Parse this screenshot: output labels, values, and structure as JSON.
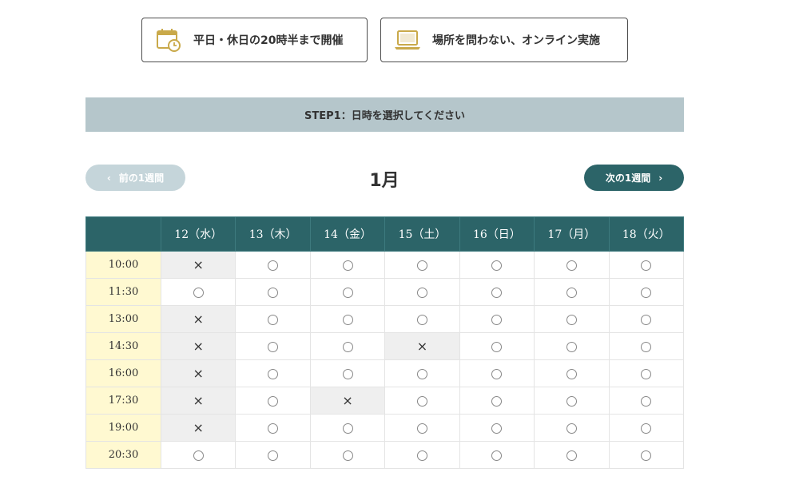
{
  "features": [
    {
      "label": "平日・休日の20時半まで開催",
      "icon": "calendar-clock-icon"
    },
    {
      "label": "場所を問わない、オンライン実施",
      "icon": "laptop-icon"
    }
  ],
  "step": {
    "label": "STEP1：日時を選択してください"
  },
  "nav": {
    "prev_label": "前の1週間",
    "next_label": "次の1週間",
    "month": "1月"
  },
  "colors": {
    "accent": "#2c6468",
    "step_bar": "#b5c6cb",
    "prev_button": "#c5d5da",
    "time_column": "#fff9d1",
    "unavailable_cell": "#efefef",
    "icon_gold": "#c9a94a"
  },
  "schedule": {
    "days": [
      "12（水）",
      "13（木）",
      "14（金）",
      "15（土）",
      "16（日）",
      "17（月）",
      "18（火）"
    ],
    "rows": [
      {
        "time": "10:00",
        "slots": [
          "×",
          "○",
          "○",
          "○",
          "○",
          "○",
          "○"
        ]
      },
      {
        "time": "11:30",
        "slots": [
          "○",
          "○",
          "○",
          "○",
          "○",
          "○",
          "○"
        ]
      },
      {
        "time": "13:00",
        "slots": [
          "×",
          "○",
          "○",
          "○",
          "○",
          "○",
          "○"
        ]
      },
      {
        "time": "14:30",
        "slots": [
          "×",
          "○",
          "○",
          "×",
          "○",
          "○",
          "○"
        ]
      },
      {
        "time": "16:00",
        "slots": [
          "×",
          "○",
          "○",
          "○",
          "○",
          "○",
          "○"
        ]
      },
      {
        "time": "17:30",
        "slots": [
          "×",
          "○",
          "×",
          "○",
          "○",
          "○",
          "○"
        ]
      },
      {
        "time": "19:00",
        "slots": [
          "×",
          "○",
          "○",
          "○",
          "○",
          "○",
          "○"
        ]
      },
      {
        "time": "20:30",
        "slots": [
          "○",
          "○",
          "○",
          "○",
          "○",
          "○",
          "○"
        ]
      }
    ]
  }
}
